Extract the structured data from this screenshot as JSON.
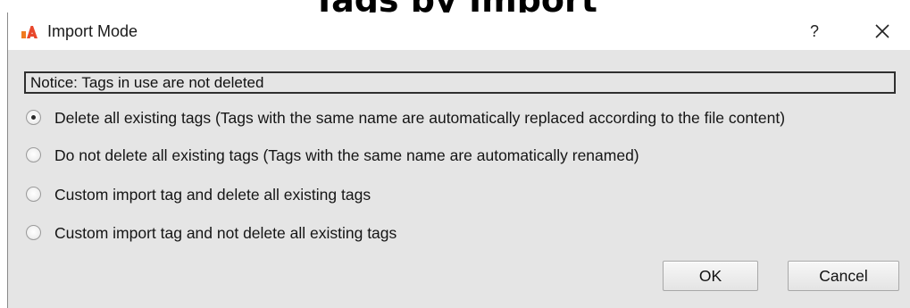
{
  "background": {
    "heading": "Tags by Import"
  },
  "dialog": {
    "title": "Import Mode",
    "help_label": "?",
    "icons": {
      "app": "app-logo-icon",
      "close": "close-icon"
    },
    "colors": {
      "content_bg": "#e5e5e5",
      "logo_orange": "#f07a1f",
      "logo_red": "#e8482c"
    }
  },
  "notice": {
    "text": "Notice: Tags in use are not deleted"
  },
  "options": [
    {
      "label": "Delete all existing tags (Tags with the same name are automatically replaced according to the file content)",
      "selected": true
    },
    {
      "label": "Do not delete all existing tags (Tags with the same name are automatically renamed)",
      "selected": false
    },
    {
      "label": "Custom import tag and delete all existing tags",
      "selected": false
    },
    {
      "label": "Custom import tag and not delete all existing tags",
      "selected": false
    }
  ],
  "buttons": {
    "ok_label": "OK",
    "cancel_label": "Cancel"
  }
}
